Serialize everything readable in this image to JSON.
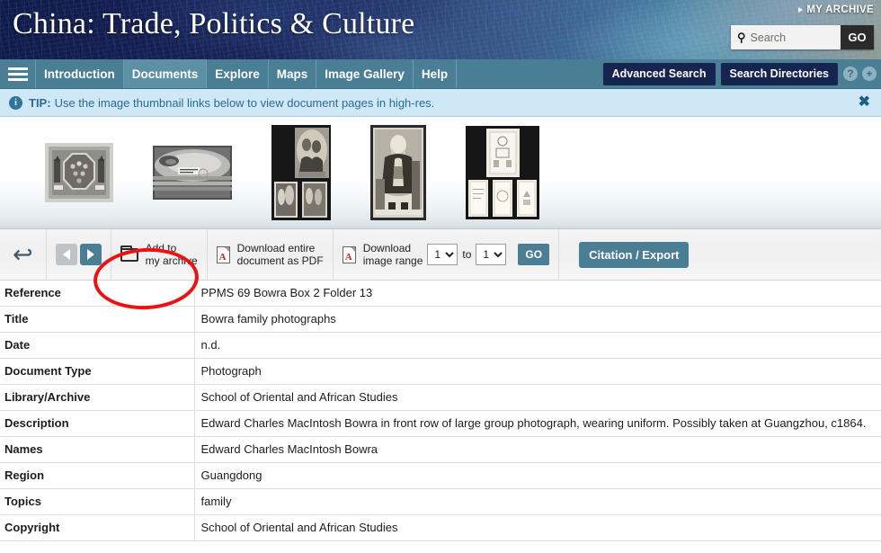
{
  "header": {
    "site_title": "China: Trade, Politics & Culture",
    "my_archive": "MY ARCHIVE",
    "search_placeholder": "Search",
    "search_value": "",
    "search_go": "GO"
  },
  "nav": {
    "menu_icon": "hamburger-icon",
    "items": [
      {
        "label": "Introduction",
        "active": false
      },
      {
        "label": "Documents",
        "active": true
      },
      {
        "label": "Explore",
        "active": false
      },
      {
        "label": "Maps",
        "active": false
      },
      {
        "label": "Image Gallery",
        "active": false
      },
      {
        "label": "Help",
        "active": false
      }
    ],
    "advanced_search": "Advanced Search",
    "search_directories": "Search Directories",
    "help_icon": "?",
    "plus_icon": "+"
  },
  "tip": {
    "icon": "i",
    "label": "TIP:",
    "text": "Use the image thumbnail links below to view document pages in high-res.",
    "close": "✖"
  },
  "thumbnails": [
    {
      "alt": "octagonal-group-photograph-thumbnail"
    },
    {
      "alt": "faded-landscape-photograph-thumbnail"
    },
    {
      "alt": "album-page-portraits-thumbnail"
    },
    {
      "alt": "seated-man-portrait-thumbnail"
    },
    {
      "alt": "album-page-documents-thumbnail"
    }
  ],
  "toolbar": {
    "back_arrow": "↩",
    "prev_label": "previous",
    "next_label": "next",
    "add_to_archive": "Add to\nmy archive",
    "download_pdf": "Download entire\ndocument as PDF",
    "download_range": "Download\nimage range",
    "range_from": "1",
    "range_to": "1",
    "to_word": "to",
    "range_options": [
      "1"
    ],
    "go_label": "GO",
    "citation_export": "Citation / Export"
  },
  "metadata": {
    "rows": [
      {
        "key": "Reference",
        "value": "PPMS 69 Bowra Box 2 Folder 13"
      },
      {
        "key": "Title",
        "value": "Bowra family photographs"
      },
      {
        "key": "Date",
        "value": "n.d."
      },
      {
        "key": "Document Type",
        "value": "Photograph"
      },
      {
        "key": "Library/Archive",
        "value": "School of Oriental and African Studies"
      },
      {
        "key": "Description",
        "value": "Edward Charles MacIntosh Bowra in front row of large group photograph, wearing uniform. Possibly taken at Guangzhou, c1864."
      },
      {
        "key": "Names",
        "value": "Edward Charles MacIntosh Bowra"
      },
      {
        "key": "Region",
        "value": "Guangdong"
      },
      {
        "key": "Topics",
        "value": "family"
      },
      {
        "key": "Copyright",
        "value": "School of Oriental and African Studies"
      }
    ]
  },
  "annotation": {
    "shape": "red-ellipse-highlight",
    "color": "#ee1111",
    "targets": "add-to-my-archive-button"
  },
  "colors": {
    "nav_bar": "#4a7e94",
    "nav_button": "#15254f",
    "tip_bar": "#cfe8f6",
    "accent": "#4a7e94"
  }
}
